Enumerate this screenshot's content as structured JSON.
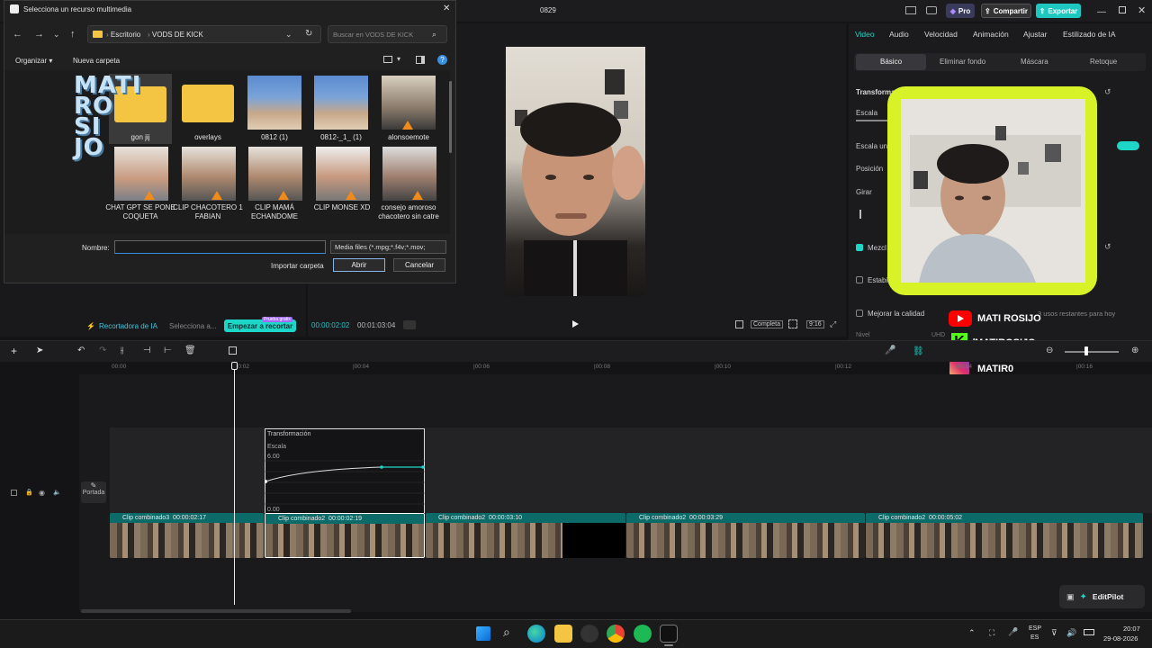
{
  "app": {
    "title": "0829",
    "pro_label": "Pro",
    "share_label": "Compartir",
    "export_label": "Exportar"
  },
  "dialog": {
    "title": "Selecciona un recurso multimedia",
    "breadcrumb": [
      "Escritorio",
      "VODS DE KICK"
    ],
    "search_placeholder": "Buscar en VODS DE KICK",
    "organize_label": "Organizar",
    "new_folder_label": "Nueva carpeta",
    "files": [
      {
        "name": "gon jij",
        "kind": "folder"
      },
      {
        "name": "overlays",
        "kind": "folder"
      },
      {
        "name": "0812 (1)",
        "kind": "image"
      },
      {
        "name": "0812-_1_ (1)",
        "kind": "image"
      },
      {
        "name": "alonsoemote",
        "kind": "video"
      },
      {
        "name": "CHAT GPT SE PONE COQUETA",
        "kind": "video"
      },
      {
        "name": "CLIP CHACOTERO 1 FABIAN",
        "kind": "video"
      },
      {
        "name": "CLIP MAMÁ ECHANDOME",
        "kind": "video"
      },
      {
        "name": "CLIP MONSE XD",
        "kind": "video"
      },
      {
        "name": "consejo amoroso chacotero sin catre",
        "kind": "video"
      }
    ],
    "name_label": "Nombre:",
    "name_value": "",
    "filter_value": "Media files (*.mpg;*.f4v;*.mov;",
    "import_folder_label": "Importar carpeta",
    "open_label": "Abrir",
    "cancel_label": "Cancelar"
  },
  "left_bottom": {
    "ai_label": "Recortadora de IA",
    "select_label": "Selecciona a...",
    "start_label": "Empezar a recortar",
    "badge": "Prueba gratis"
  },
  "player": {
    "time_current": "00:00:02:02",
    "time_total": "00:01:03:04",
    "complete_label": "Completa",
    "ratio_label": "9:16"
  },
  "right_panel": {
    "tabs": [
      "Video",
      "Audio",
      "Velocidad",
      "Animación",
      "Ajustar",
      "Estilizado de IA"
    ],
    "subtabs": [
      "Básico",
      "Eliminar fondo",
      "Máscara",
      "Retoque"
    ],
    "labels": {
      "transform": "Transformació",
      "scale": "Escala",
      "uniform": "Escala unif",
      "position": "Posición",
      "rotate": "Girar",
      "blend": "Mezcl",
      "stabilize": "Estabili",
      "enhance": "Mejorar la calidad",
      "uses_left": "3 usos restantes para hoy",
      "level": "Nivel",
      "level_value": "UHD"
    }
  },
  "overlay": {
    "youtube": "MATI ROSIJO",
    "kick": "/MATIROSIJO",
    "instagram": "MATIR0",
    "logo_text": "MATI ROSIJO"
  },
  "timeline": {
    "ruler": [
      "00:00",
      "|00:02",
      "|00:04",
      "|00:06",
      "|00:08",
      "|00:10",
      "|00:12",
      "|00:14",
      "|00:16"
    ],
    "cover_label": "Portada",
    "keyframe_panel": {
      "title": "Transformación",
      "param": "Escala",
      "ymax": "6.00",
      "ymin": "0.00"
    },
    "clips": [
      {
        "label": "Clip combinado3",
        "duration": "00:00:02:17"
      },
      {
        "label": "Clip combinado2",
        "duration": "00:00:02:19"
      },
      {
        "label": "Clip combinado2",
        "duration": "00:00:03:10"
      },
      {
        "label": "Clip combinado2",
        "duration": "00:00:03:29"
      },
      {
        "label": "Clip combinado2",
        "duration": "00:00:05:02"
      }
    ],
    "editpilot_label": "EditPilot"
  },
  "taskbar": {
    "lang_top": "ESP",
    "lang_bottom": "ES",
    "time": "20:07",
    "date": "29-08-2026"
  }
}
